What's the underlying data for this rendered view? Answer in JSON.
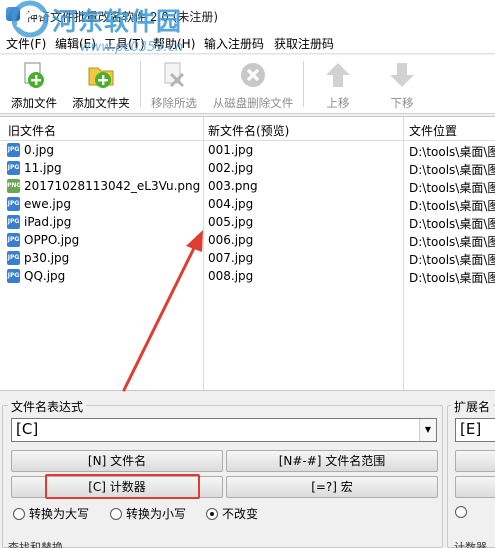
{
  "window": {
    "title": "神奇文件批量改名软件 2.0 (未注册)",
    "watermark_text": "河东软件园",
    "watermark_url": "www.pc0359.cn"
  },
  "menu": {
    "items": [
      "文件(F)",
      "编辑(E)",
      "工具(T)",
      "帮助(H)",
      "输入注册码",
      "获取注册码"
    ]
  },
  "toolbar": {
    "buttons": [
      {
        "label": "添加文件",
        "icon": "add-file-icon",
        "enabled": true
      },
      {
        "label": "添加文件夹",
        "icon": "add-folder-icon",
        "enabled": true
      },
      {
        "label": "移除所选",
        "icon": "remove-selected-icon",
        "enabled": false
      },
      {
        "label": "从磁盘删除文件",
        "icon": "delete-from-disk-icon",
        "enabled": false
      },
      {
        "label": "上移",
        "icon": "move-up-icon",
        "enabled": false
      },
      {
        "label": "下移",
        "icon": "move-down-icon",
        "enabled": false
      }
    ]
  },
  "file_list": {
    "columns": [
      "旧文件名",
      "新文件名(预览)",
      "文件位置"
    ],
    "rows": [
      {
        "old": "0.jpg",
        "new": "001.jpg",
        "path": "D:\\tools\\桌面\\图",
        "type": "jpg"
      },
      {
        "old": "11.jpg",
        "new": "002.jpg",
        "path": "D:\\tools\\桌面\\图",
        "type": "jpg"
      },
      {
        "old": "20171028113042_eL3Vu.png",
        "new": "003.png",
        "path": "D:\\tools\\桌面\\图",
        "type": "png"
      },
      {
        "old": "ewe.jpg",
        "new": "004.jpg",
        "path": "D:\\tools\\桌面\\图",
        "type": "jpg"
      },
      {
        "old": "iPad.jpg",
        "new": "005.jpg",
        "path": "D:\\tools\\桌面\\图",
        "type": "jpg"
      },
      {
        "old": "OPPO.jpg",
        "new": "006.jpg",
        "path": "D:\\tools\\桌面\\图",
        "type": "jpg"
      },
      {
        "old": "p30.jpg",
        "new": "007.jpg",
        "path": "D:\\tools\\桌面\\图",
        "type": "jpg"
      },
      {
        "old": "QQ.jpg",
        "new": "008.jpg",
        "path": "D:\\tools\\桌面\\图",
        "type": "jpg"
      }
    ]
  },
  "expression_panel": {
    "title": "文件名表达式",
    "value": "[C]",
    "buttons": {
      "filename": "[N] 文件名",
      "range": "[N#-#] 文件名范围",
      "counter": "[C] 计数器",
      "macro": "[=?] 宏"
    },
    "case_options": [
      "转换为大写",
      "转换为小写",
      "不改变"
    ],
    "selected_case": "不改变"
  },
  "extension_panel": {
    "title": "扩展名",
    "value": "[E]"
  },
  "bottom_labels": {
    "left": "查找和替换",
    "right": "计数器"
  },
  "annotation": {
    "color": "#e03c31"
  }
}
